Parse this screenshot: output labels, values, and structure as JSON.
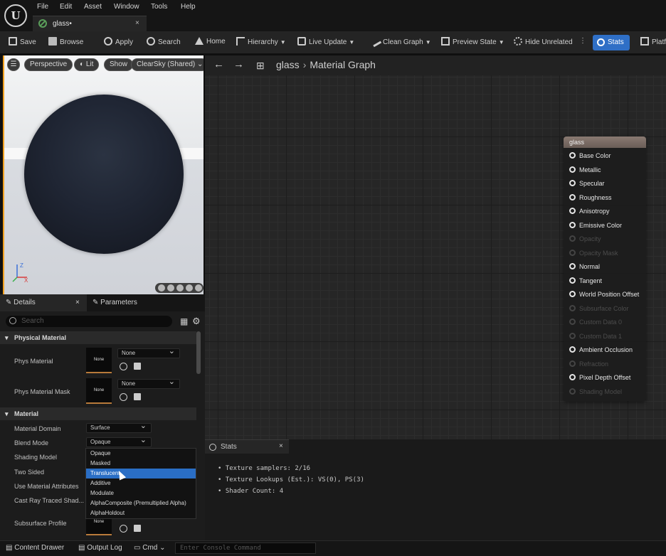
{
  "app": {
    "logo": "U"
  },
  "menu": [
    "File",
    "Edit",
    "Asset",
    "Window",
    "Tools",
    "Help"
  ],
  "tab": {
    "label": "glass•"
  },
  "toolbar": {
    "save": "Save",
    "browse": "Browse",
    "apply": "Apply",
    "search": "Search",
    "home": "Home",
    "hierarchy": "Hierarchy",
    "live_update": "Live Update",
    "clean_graph": "Clean Graph",
    "preview_state": "Preview State",
    "hide_unrelated": "Hide Unrelated",
    "stats": "Stats",
    "platforms": "Platf"
  },
  "viewport": {
    "perspective": "Perspective",
    "lit": "Lit",
    "show": "Show",
    "sky": "ClearSky (Shared)",
    "axis_z": "Z",
    "axis_x": "X"
  },
  "details": {
    "tab_details": "Details",
    "tab_parameters": "Parameters",
    "search_placeholder": "Search",
    "section_physical": "Physical Material",
    "phys_material": "Phys Material",
    "phys_material_mask": "Phys Material Mask",
    "none_thumb": "None",
    "none_combo": "None",
    "section_material": "Material",
    "material_domain": "Material Domain",
    "material_domain_value": "Surface",
    "blend_mode": "Blend Mode",
    "blend_mode_value": "Opaque",
    "shading_model": "Shading Model",
    "two_sided": "Two Sided",
    "use_material_attributes": "Use Material Attributes",
    "cast_ray": "Cast Ray Traced Shad...",
    "subsurface_profile": "Subsurface Profile"
  },
  "dropdown": {
    "options": [
      "Opaque",
      "Masked",
      "Translucent",
      "Additive",
      "Modulate",
      "AlphaComposite (Premultiplied Alpha)",
      "AlphaHoldout"
    ],
    "selected_index": 2
  },
  "graph": {
    "asset": "glass",
    "breadcrumb": "Material Graph",
    "node_title": "glass",
    "pins": [
      {
        "label": "Base Color",
        "enabled": true
      },
      {
        "label": "Metallic",
        "enabled": true
      },
      {
        "label": "Specular",
        "enabled": true
      },
      {
        "label": "Roughness",
        "enabled": true
      },
      {
        "label": "Anisotropy",
        "enabled": true
      },
      {
        "label": "Emissive Color",
        "enabled": true
      },
      {
        "label": "Opacity",
        "enabled": false
      },
      {
        "label": "Opacity Mask",
        "enabled": false
      },
      {
        "label": "Normal",
        "enabled": true
      },
      {
        "label": "Tangent",
        "enabled": true
      },
      {
        "label": "World Position Offset",
        "enabled": true
      },
      {
        "label": "Subsurface Color",
        "enabled": false
      },
      {
        "label": "Custom Data 0",
        "enabled": false
      },
      {
        "label": "Custom Data 1",
        "enabled": false
      },
      {
        "label": "Ambient Occlusion",
        "enabled": true
      },
      {
        "label": "Refraction",
        "enabled": false
      },
      {
        "label": "Pixel Depth Offset",
        "enabled": true
      },
      {
        "label": "Shading Model",
        "enabled": false
      }
    ]
  },
  "stats": {
    "tab": "Stats",
    "lines": [
      "• Texture samplers: 2/16",
      "• Texture Lookups (Est.): VS(0), PS(3)",
      "• Shader Count: 4"
    ]
  },
  "bottom": {
    "content_drawer": "Content Drawer",
    "output_log": "Output Log",
    "cmd": "Cmd",
    "console_placeholder": "Enter Console Command"
  }
}
